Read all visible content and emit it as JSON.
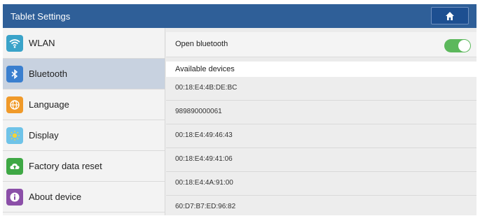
{
  "title": "Tablet Settings",
  "home_icon": "home-icon",
  "colors": {
    "titlebar": "#2f5f98",
    "selected_item": "#c8d2e0",
    "toggle_on": "#5cb85c"
  },
  "sidebar": {
    "items": [
      {
        "label": "WLAN",
        "icon": "wifi-icon",
        "selected": false
      },
      {
        "label": "Bluetooth",
        "icon": "bluetooth-icon",
        "selected": true
      },
      {
        "label": "Language",
        "icon": "globe-icon",
        "selected": false
      },
      {
        "label": "Display",
        "icon": "brightness-icon",
        "selected": false
      },
      {
        "label": "Factory data reset",
        "icon": "cloud-upload-icon",
        "selected": false
      },
      {
        "label": "About device",
        "icon": "info-icon",
        "selected": false
      }
    ]
  },
  "bluetooth": {
    "toggle_label": "Open bluetooth",
    "toggle_on": true,
    "available_label": "Available devices",
    "devices": [
      "00:18:E4:4B:DE:BC",
      "989890000061",
      "00:18:E4:49:46:43",
      "00:18:E4:49:41:06",
      "00:18:E4:4A:91:00",
      "60:D7:B7:ED:96:82"
    ]
  }
}
